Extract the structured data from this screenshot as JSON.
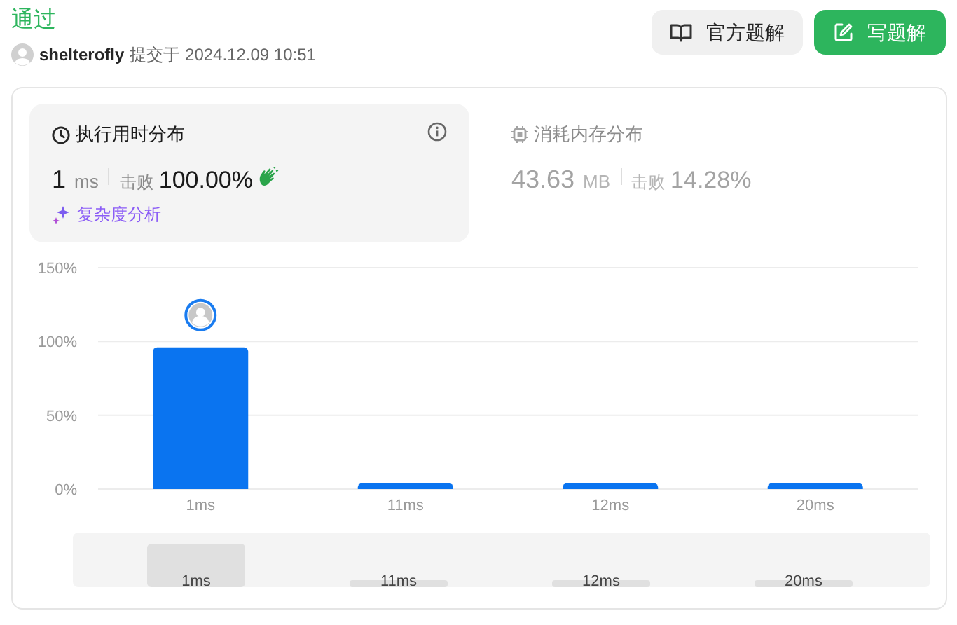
{
  "status": "通过",
  "submission": {
    "user": "shelterofly",
    "submitted": "提交于 2024.12.09 10:51"
  },
  "buttons": [
    {
      "label": "官方题解",
      "kind": "secondary"
    },
    {
      "label": "写题解",
      "kind": "primary"
    }
  ],
  "metrics": [
    {
      "kind": "time",
      "title": "执行用时分布",
      "selected": true,
      "value": "1",
      "unit": "ms",
      "beats_label": "击败",
      "beats": "100.00%",
      "link": "复杂度分析"
    },
    {
      "kind": "memory",
      "title": "消耗内存分布",
      "selected": false,
      "value": "43.63",
      "unit": "MB",
      "beats_label": "击败",
      "beats": "14.28%"
    }
  ],
  "chart": {
    "chart_data": {
      "type": "bar",
      "categories": [
        "1ms",
        "11ms",
        "12ms",
        "20ms"
      ],
      "series": [
        {
          "color": "#0a74f0",
          "values": [
            96,
            4,
            4,
            4
          ]
        }
      ],
      "ylim": [
        0,
        150
      ],
      "yticks": [
        {
          "value": 0,
          "label": "0%"
        },
        {
          "value": 50,
          "label": "50%"
        },
        {
          "value": 100,
          "label": "100%"
        },
        {
          "value": 150,
          "label": "150%"
        }
      ]
    },
    "navigator": [
      {
        "label": "1ms",
        "selected": true
      },
      {
        "label": "11ms",
        "selected": false
      },
      {
        "label": "12ms",
        "selected": false
      },
      {
        "label": "20ms",
        "selected": false
      }
    ]
  }
}
